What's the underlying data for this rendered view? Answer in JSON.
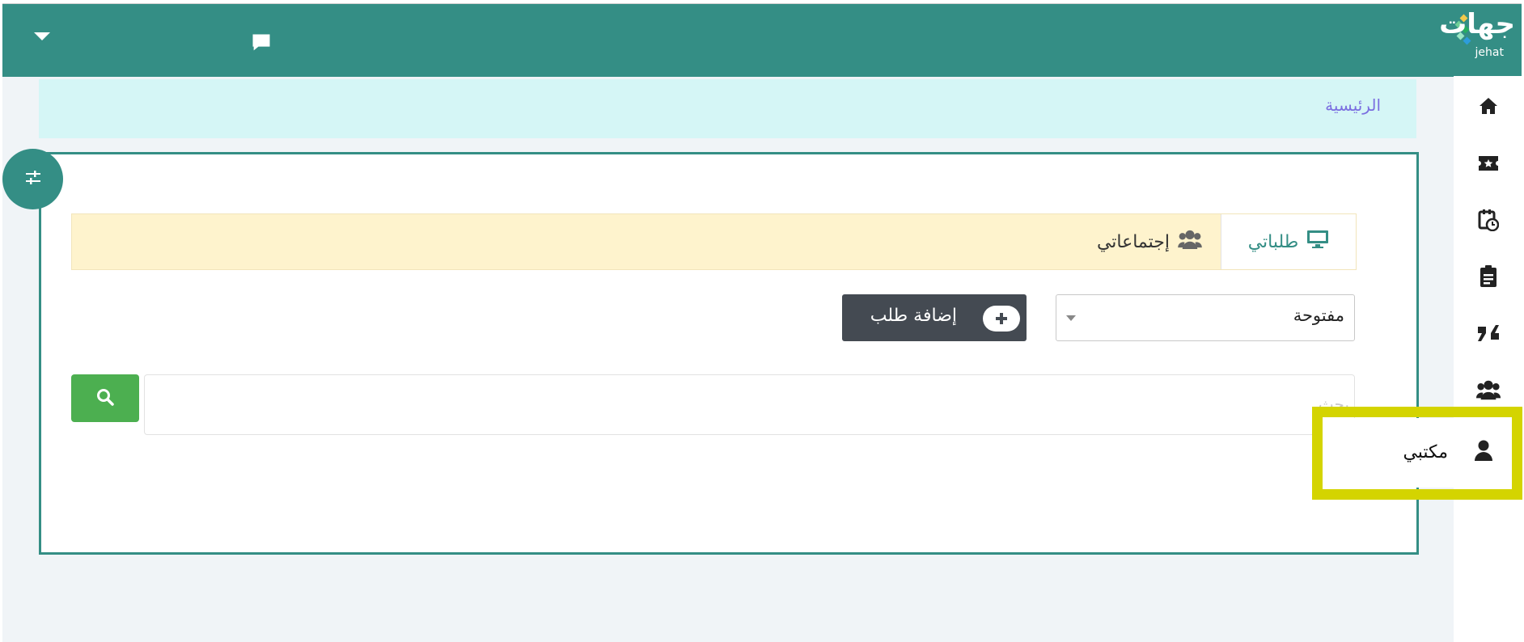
{
  "brand": {
    "logo_text": "جهات",
    "logo_sub": "jehat"
  },
  "breadcrumb": {
    "home": "الرئيسية"
  },
  "tabs": [
    {
      "label": "طلباتي",
      "icon": "monitor-icon",
      "active": true
    },
    {
      "label": "إجتماعاتي",
      "icon": "users-icon",
      "active": false
    }
  ],
  "filter": {
    "selected": "مفتوحة"
  },
  "actions": {
    "add_request": "إضافة طلب"
  },
  "search": {
    "placeholder": "بحث"
  },
  "sidebar": {
    "icons": [
      "home-icon",
      "ticket-icon",
      "calendar-clock-icon",
      "clipboard-icon",
      "quote-icon",
      "users-icon",
      "user-icon"
    ],
    "hover_label": "مكتبي"
  },
  "colors": {
    "primary": "#348e85",
    "breadcrumb_bg": "#d5f6f6",
    "tab_bg": "#fef3cd",
    "search_btn": "#4caf50",
    "add_btn": "#444a52",
    "highlight": "#d4d400"
  }
}
